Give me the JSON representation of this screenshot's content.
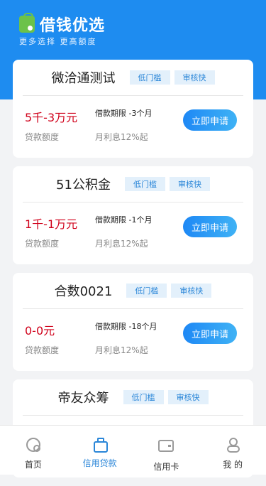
{
  "header": {
    "title": "借钱优选",
    "subtitle": "更多选择 更高额度"
  },
  "products": [
    {
      "name": "微洽通测试",
      "tags": [
        "低门槛",
        "审核快"
      ],
      "amount": "5千-3万元",
      "amount_label": "贷款额度",
      "term": "借款期限 -3个月",
      "rate": "月利息12%起",
      "apply_label": "立即申请"
    },
    {
      "name": "51公积金",
      "tags": [
        "低门槛",
        "审核快"
      ],
      "amount": "1千-1万元",
      "amount_label": "贷款额度",
      "term": "借款期限 -1个月",
      "rate": "月利息12%起",
      "apply_label": "立即申请"
    },
    {
      "name": "合数0021",
      "tags": [
        "低门槛",
        "审核快"
      ],
      "amount": "0-0元",
      "amount_label": "贷款额度",
      "term": "借款期限 -18个月",
      "rate": "月利息12%起",
      "apply_label": "立即申请"
    },
    {
      "name": "帝友众筹",
      "tags": [
        "低门槛",
        "审核快"
      ]
    }
  ],
  "tabbar": {
    "items": [
      {
        "label": "首页",
        "icon": "home-icon"
      },
      {
        "label": "信用贷款",
        "icon": "loan-icon",
        "active": true
      },
      {
        "label": "信用卡",
        "icon": "credit-card-icon"
      },
      {
        "label": "我 的",
        "icon": "user-icon"
      }
    ]
  },
  "colors": {
    "primary": "#1e8cf0",
    "amount": "#d0021b",
    "tag_bg": "#e3f0fb"
  }
}
